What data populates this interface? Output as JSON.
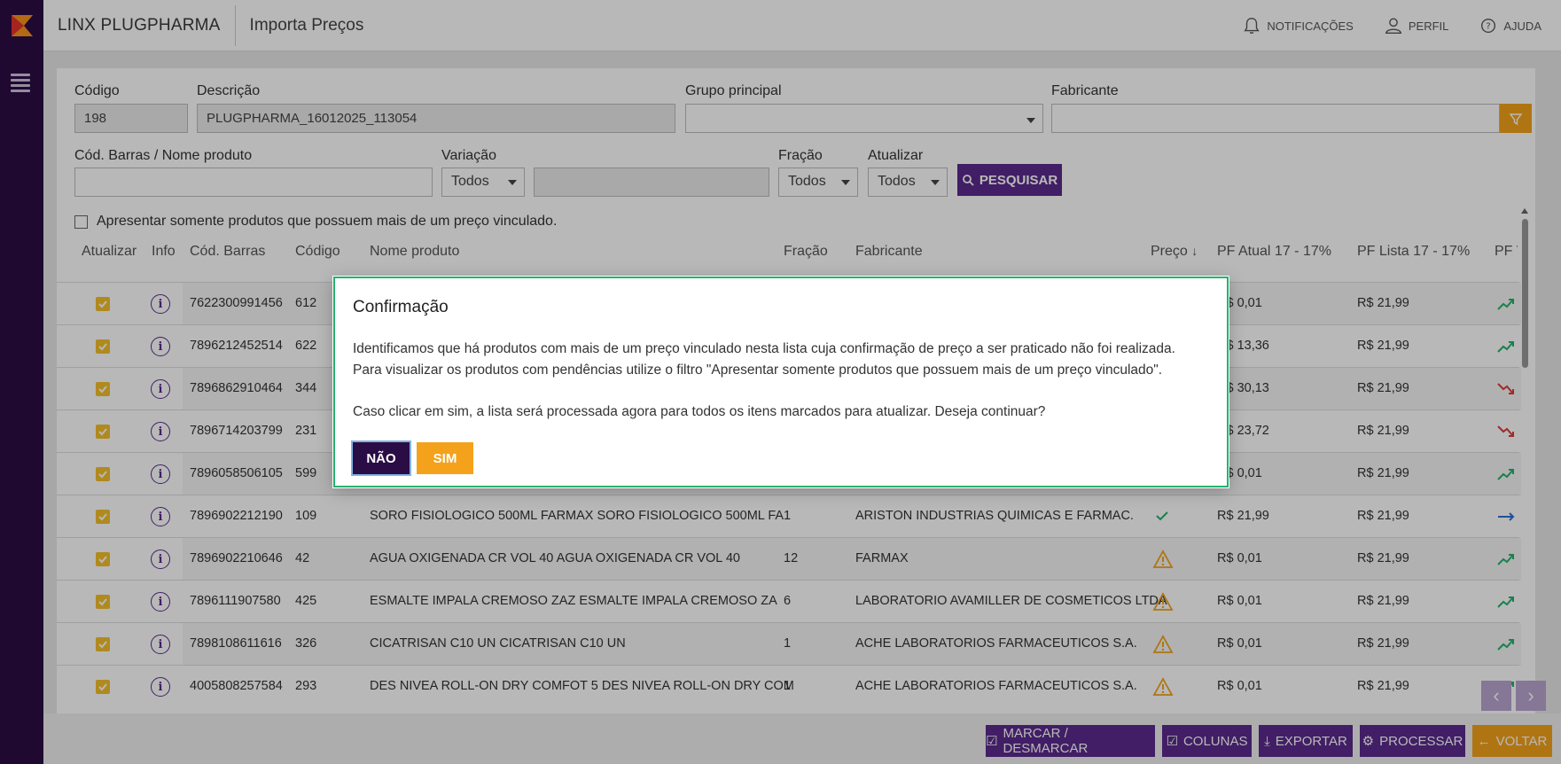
{
  "app": {
    "brand": "LINX PLUGPHARMA",
    "page_title": "Importa Preços",
    "nav": {
      "notifications": "NOTIFICAÇÕES",
      "profile": "PERFIL",
      "help": "AJUDA"
    }
  },
  "form": {
    "codigo": {
      "label": "Código",
      "value": "198"
    },
    "descricao": {
      "label": "Descrição",
      "value": "PLUGPHARMA_16012025_113054"
    },
    "grupo": {
      "label": "Grupo principal",
      "value": ""
    },
    "fabricante": {
      "label": "Fabricante",
      "value": ""
    },
    "barras": {
      "label": "Cód. Barras / Nome produto",
      "value": ""
    },
    "variacao": {
      "label": "Variação",
      "selected": "Todos"
    },
    "fracao": {
      "label": "Fração",
      "selected": "Todos"
    },
    "atualizar": {
      "label": "Atualizar",
      "selected": "Todos"
    },
    "search_label": "PESQUISAR",
    "only_multi_price": "Apresentar somente produtos que possuem mais de um preço vinculado."
  },
  "table": {
    "headers": {
      "atualizar": "Atualizar",
      "info": "Info",
      "barras": "Cód. Barras",
      "codigo": "Código",
      "nome": "Nome produto",
      "fracao": "Fração",
      "fabricante": "Fabricante",
      "preco": "Preço",
      "pf_atual": "PF Atual 17 - 17%",
      "pf_lista": "PF Lista 17 - 17%",
      "pf_v": "PF V"
    },
    "rows": [
      {
        "barras": "7622300991456",
        "codigo": "612",
        "nome": "",
        "fracao": "",
        "fabricante": "",
        "status": "",
        "pf_atual": "R$ 0,01",
        "pf_lista": "R$ 21,99",
        "trend": "up"
      },
      {
        "barras": "7896212452514",
        "codigo": "622",
        "nome": "",
        "fracao": "",
        "fabricante": "",
        "status": "",
        "pf_atual": "R$ 13,36",
        "pf_lista": "R$ 21,99",
        "trend": "up"
      },
      {
        "barras": "7896862910464",
        "codigo": "344",
        "nome": "",
        "fracao": "",
        "fabricante": "",
        "status": "",
        "pf_atual": "R$ 30,13",
        "pf_lista": "R$ 21,99",
        "trend": "down"
      },
      {
        "barras": "7896714203799",
        "codigo": "231",
        "nome": "",
        "fracao": "",
        "fabricante": "",
        "status": "",
        "pf_atual": "R$ 23,72",
        "pf_lista": "R$ 21,99",
        "trend": "down"
      },
      {
        "barras": "7896058506105",
        "codigo": "599",
        "nome": "",
        "fracao": "",
        "fabricante": "",
        "status": "",
        "pf_atual": "R$ 0,01",
        "pf_lista": "R$ 21,99",
        "trend": "up"
      },
      {
        "barras": "7896902212190",
        "codigo": "109",
        "nome": "SORO FISIOLOGICO 500ML FARMAX SORO FISIOLOGICO 500ML FA",
        "fracao": "1",
        "fabricante": "ARISTON INDUSTRIAS QUIMICAS E FARMAC.",
        "status": "check",
        "pf_atual": "R$ 21,99",
        "pf_lista": "R$ 21,99",
        "trend": "flat"
      },
      {
        "barras": "7896902210646",
        "codigo": "42",
        "nome": "AGUA OXIGENADA CR VOL 40 AGUA OXIGENADA CR VOL 40",
        "fracao": "12",
        "fabricante": "FARMAX",
        "status": "warn",
        "pf_atual": "R$ 0,01",
        "pf_lista": "R$ 21,99",
        "trend": "up"
      },
      {
        "barras": "7896111907580",
        "codigo": "425",
        "nome": "ESMALTE IMPALA CREMOSO ZAZ ESMALTE IMPALA CREMOSO ZA",
        "fracao": "6",
        "fabricante": "LABORATORIO AVAMILLER DE COSMETICOS LTDA",
        "status": "warn",
        "pf_atual": "R$ 0,01",
        "pf_lista": "R$ 21,99",
        "trend": "up"
      },
      {
        "barras": "7898108611616",
        "codigo": "326",
        "nome": "CICATRISAN C10 UN CICATRISAN C10 UN",
        "fracao": "1",
        "fabricante": "ACHE LABORATORIOS FARMACEUTICOS S.A.",
        "status": "warn",
        "pf_atual": "R$ 0,01",
        "pf_lista": "R$ 21,99",
        "trend": "up"
      },
      {
        "barras": "4005808257584",
        "codigo": "293",
        "nome": "DES NIVEA ROLL-ON DRY COMFOT 5 DES NIVEA ROLL-ON DRY COM",
        "fracao": "1",
        "fabricante": "ACHE LABORATORIOS FARMACEUTICOS S.A.",
        "status": "warn",
        "pf_atual": "R$ 0,01",
        "pf_lista": "R$ 21,99",
        "trend": "up"
      }
    ]
  },
  "footer": {
    "mark": "MARCAR / DESMARCAR",
    "columns": "COLUNAS",
    "export": "EXPORTAR",
    "process": "PROCESSAR",
    "back": "VOLTAR"
  },
  "modal": {
    "title": "Confirmação",
    "line1": "Identificamos que há produtos com mais de um preço vinculado nesta lista cuja confirmação de preço a ser praticado não foi realizada.",
    "line2": "Para visualizar os produtos com pendências utilize o filtro \"Apresentar somente produtos que possuem mais de um preço vinculado\".",
    "line3": "Caso clicar em sim, a lista será processada agora para todos os itens marcados para atualizar. Deseja continuar?",
    "no_label": "NÃO",
    "yes_label": "SIM"
  },
  "colors": {
    "rail": "#2b0d45",
    "primary": "#5b2a8c",
    "accent": "#f4a21b",
    "success": "#23b26f",
    "danger": "#e0393e"
  }
}
